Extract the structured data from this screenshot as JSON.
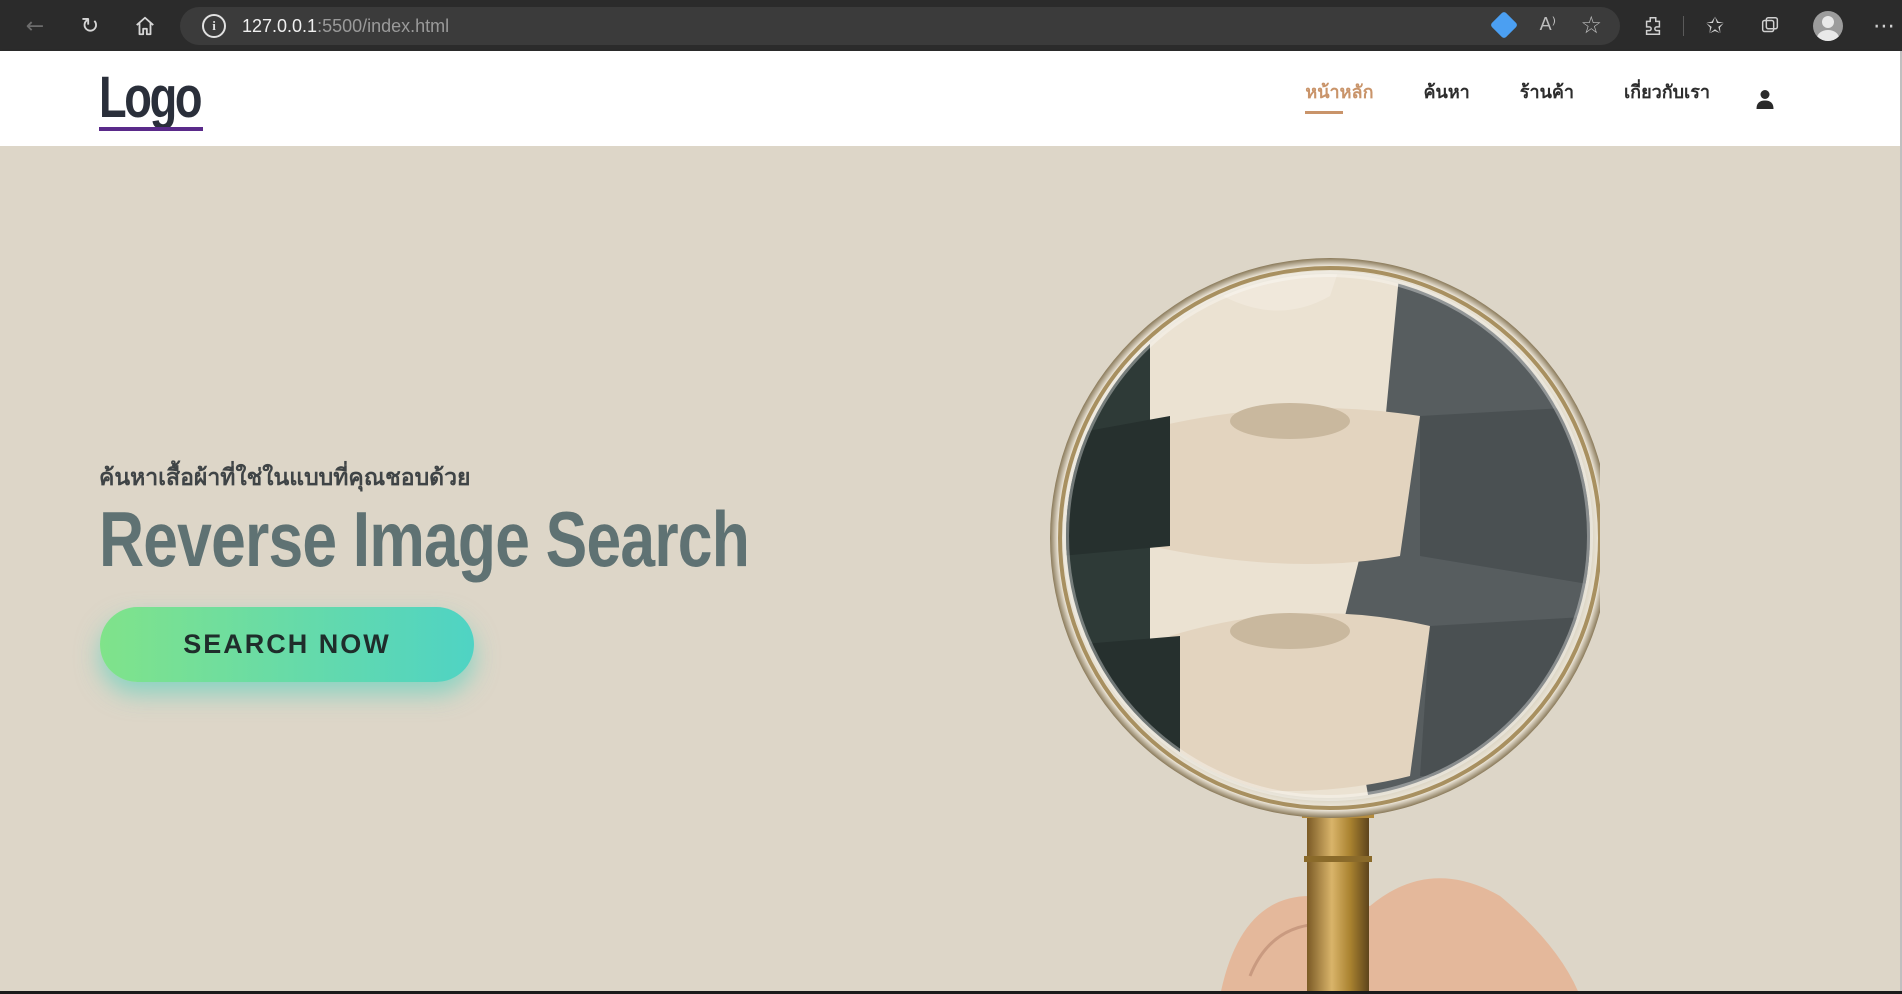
{
  "browser": {
    "url_host": "127.0.0.1",
    "url_rest": ":5500/index.html",
    "read_aloud": "A⁾"
  },
  "header": {
    "logo": "Logo",
    "menu": [
      {
        "label": "หน้าหลัก",
        "active": true
      },
      {
        "label": "ค้นหา",
        "active": false
      },
      {
        "label": "ร้านค้า",
        "active": false
      },
      {
        "label": "เกี่ยวกับเรา",
        "active": false
      }
    ]
  },
  "hero": {
    "subtitle": "ค้นหาเสื้อผ้าที่ใช่ในแบบที่คุณชอบด้วย",
    "title": "Reverse Image Search",
    "cta": "SEARCH NOW"
  },
  "colors": {
    "background": "#ddd6c8",
    "title": "#5f7273",
    "active_menu": "#c9946a",
    "cta_from": "#80e38a",
    "cta_to": "#4fd3c4"
  },
  "icons": [
    "back-icon",
    "reload-icon",
    "home-icon",
    "info-icon",
    "tag-icon",
    "read-aloud-icon",
    "favorite-icon",
    "extensions-icon",
    "favorites-icon",
    "collections-icon",
    "profile-icon",
    "more-icon",
    "user-icon",
    "magnifier-image"
  ]
}
